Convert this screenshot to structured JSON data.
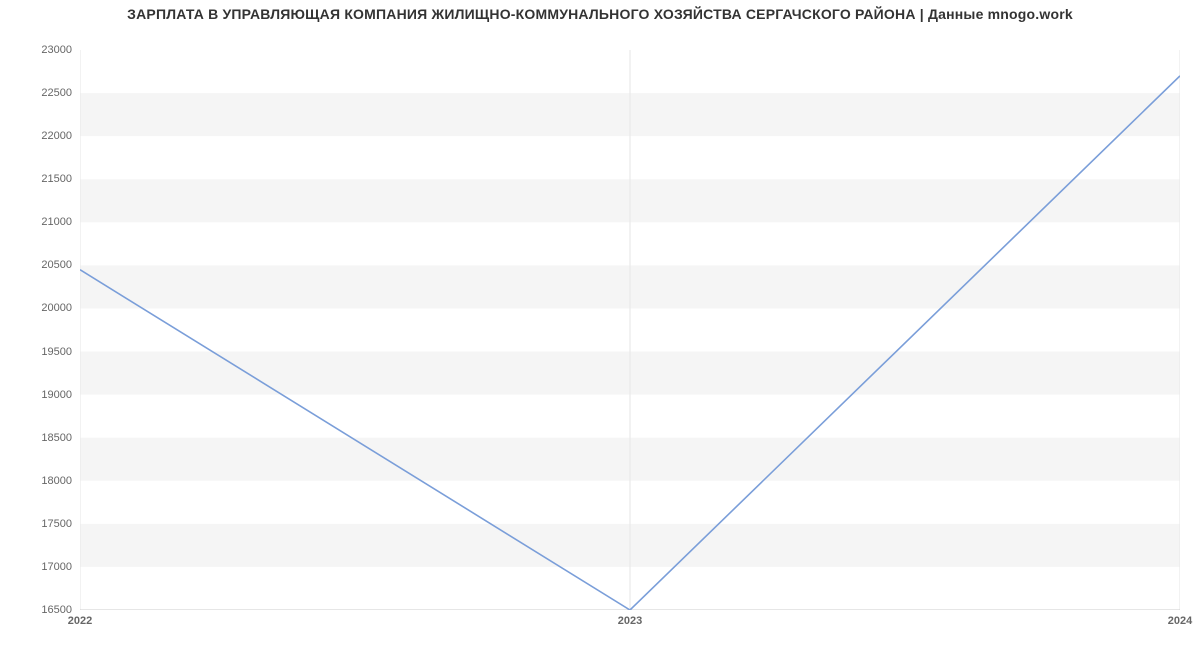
{
  "chart_data": {
    "type": "line",
    "title": "ЗАРПЛАТА В УПРАВЛЯЮЩАЯ КОМПАНИЯ ЖИЛИЩНО-КОММУНАЛЬНОГО ХОЗЯЙСТВА СЕРГАЧСКОГО РАЙОНА  | Данные mnogo.work",
    "categories": [
      "2022",
      "2023",
      "2024"
    ],
    "values": [
      20450,
      16500,
      22700
    ],
    "xlabel": "",
    "ylabel": "",
    "ylim": [
      16500,
      23000
    ],
    "y_ticks": [
      16500,
      17000,
      17500,
      18000,
      18500,
      19000,
      19500,
      20000,
      20500,
      21000,
      21500,
      22000,
      22500,
      23000
    ],
    "x_ticks": [
      "2022",
      "2023",
      "2024"
    ],
    "colors": {
      "line": "#7a9ed9",
      "band": "#f5f5f5"
    }
  }
}
